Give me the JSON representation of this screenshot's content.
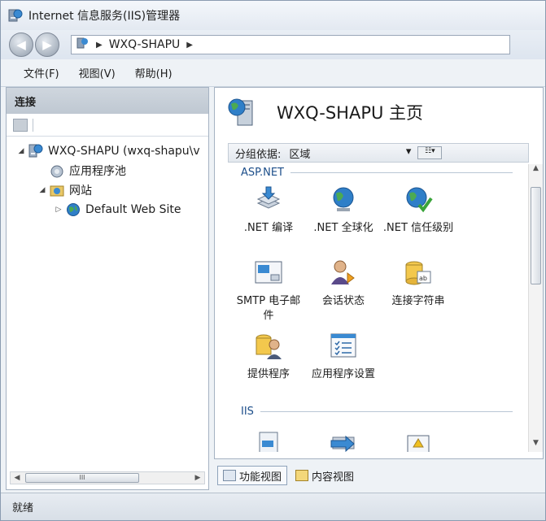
{
  "window": {
    "title": "Internet 信息服务(IIS)管理器"
  },
  "address": {
    "path": "WXQ-SHAPU",
    "sep": "▶",
    "back": "◀",
    "forward": "▶"
  },
  "menu": {
    "items": [
      "文件(F)",
      "视图(V)",
      "帮助(H)"
    ]
  },
  "connections": {
    "header": "连接",
    "tree": [
      {
        "label": "WXQ-SHAPU (wxq-shapu\\v",
        "toggle": "◢",
        "icon": "server-icon"
      },
      {
        "label": "应用程序池",
        "toggle": "",
        "icon": "app-pool-icon"
      },
      {
        "label": "网站",
        "toggle": "◢",
        "icon": "sites-folder-icon"
      },
      {
        "label": "Default Web Site",
        "toggle": "▷",
        "icon": "globe-icon"
      }
    ],
    "scroll_mark": "III"
  },
  "home": {
    "title": "WXQ-SHAPU 主页",
    "group_by_label": "分组依据:",
    "group_by_value": "区域",
    "dropdown_arrow": "▾",
    "view_button": "☷▾"
  },
  "sections": [
    {
      "name": "ASP.NET",
      "features": [
        {
          "label": ".NET 编译",
          "icon": "net-compile-icon"
        },
        {
          "label": ".NET 全球化",
          "icon": "net-globalization-icon"
        },
        {
          "label": ".NET 信任级别",
          "icon": "net-trust-icon"
        },
        {
          "label": "SMTP 电子邮件",
          "icon": "smtp-email-icon"
        },
        {
          "label": "会话状态",
          "icon": "session-state-icon"
        },
        {
          "label": "连接字符串",
          "icon": "connection-strings-icon"
        },
        {
          "label": "提供程序",
          "icon": "providers-icon"
        },
        {
          "label": "应用程序设置",
          "icon": "app-settings-icon"
        }
      ]
    },
    {
      "name": "IIS",
      "features": []
    }
  ],
  "view_tabs": {
    "features_view": "功能视图",
    "content_view": "内容视图"
  },
  "status": {
    "text": "就绪"
  },
  "colors": {
    "accent": "#1c4e8a",
    "pane_header": "#c6ced8",
    "window_bg": "#eef2f6"
  }
}
